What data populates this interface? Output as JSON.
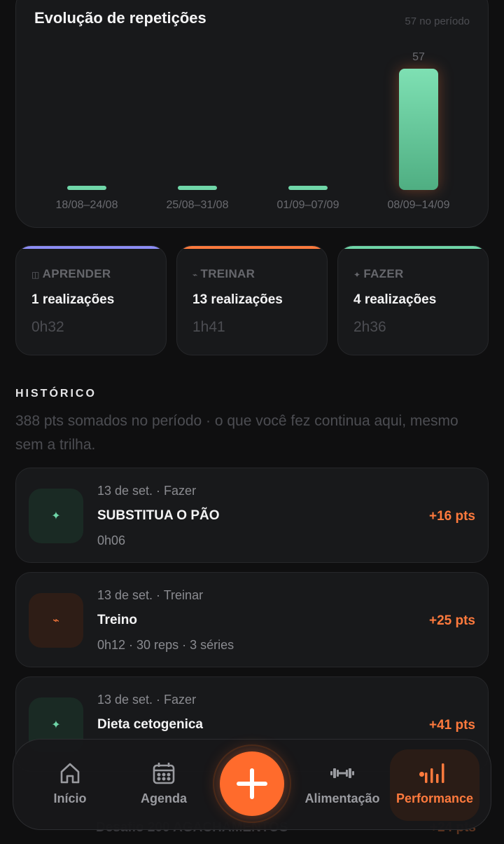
{
  "chart_data": {
    "type": "bar",
    "title": "Evolução de repetições",
    "subtitle": "57 no período",
    "categories": [
      "18/08–24/08",
      "25/08–31/08",
      "01/09–07/09",
      "08/09–14/09"
    ],
    "values": [
      0,
      0,
      0,
      57
    ],
    "value_labels": [
      "",
      "",
      "",
      "57"
    ],
    "ylim": [
      0,
      57
    ],
    "grid": false,
    "colors": {
      "bar": "#6fd6a8",
      "bar_top": "#7ee0b3",
      "bar_bottom": "#4fae82",
      "axis_text": "#6a6b70",
      "label": "#6a6b70"
    }
  },
  "categories": [
    {
      "icon": "book-icon",
      "glyph": "◫",
      "label": "APRENDER",
      "count": "1 realizações",
      "time": "0h32",
      "accent": "#8c8df5"
    },
    {
      "icon": "lightning-icon",
      "glyph": "⌁",
      "label": "TREINAR",
      "count": "13 realizações",
      "time": "1h41",
      "accent": "#ff7a3d"
    },
    {
      "icon": "sparkle-icon",
      "glyph": "✦",
      "label": "FAZER",
      "count": "4 realizações",
      "time": "2h36",
      "accent": "#6fd6a8"
    }
  ],
  "history": {
    "title": "HISTÓRICO",
    "subtitle": "388 pts somados no período · o que você fez continua aqui, mesmo sem a trilha.",
    "items": [
      {
        "icon": "sparkle-icon",
        "glyph": "✦",
        "kind": "fazer",
        "meta": "13 de set. · Fazer",
        "name": "SUBSTITUA O PÃO",
        "detail": "0h06",
        "pts": "+16 pts"
      },
      {
        "icon": "lightning-icon",
        "glyph": "⌁",
        "kind": "treinar",
        "meta": "13 de set. · Treinar",
        "name": "Treino",
        "detail": "0h12 · 30 reps · 3 séries",
        "pts": "+25 pts"
      },
      {
        "icon": "sparkle-icon",
        "glyph": "✦",
        "kind": "fazer",
        "meta": "13 de set. · Fazer",
        "name": "Dieta cetogenica",
        "detail": "",
        "pts": "+41 pts"
      }
    ],
    "partial": {
      "name": "Desafio 200 AGACHAMENTOS",
      "pts": "+24 pts"
    }
  },
  "nav": {
    "items": [
      {
        "icon": "home-icon",
        "label": "Início"
      },
      {
        "icon": "calendar-icon",
        "label": "Agenda"
      },
      {
        "icon": "dumbbell-icon",
        "label": "Alimentação"
      },
      {
        "icon": "bar-chart-icon",
        "label": "Performance"
      }
    ],
    "active": "Performance",
    "fab_icon": "plus-icon",
    "accent": "#ff7a3d"
  }
}
